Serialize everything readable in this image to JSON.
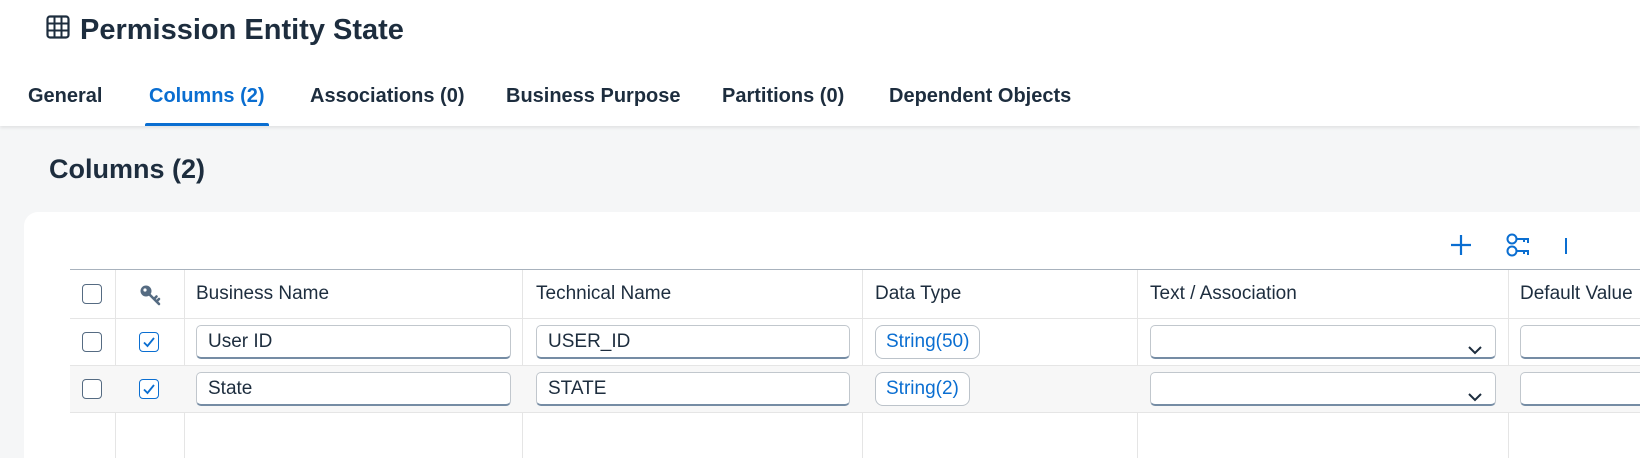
{
  "header": {
    "title": "Permission Entity State",
    "title_icon": "table-icon"
  },
  "tabs": [
    {
      "label": "General",
      "selected": false
    },
    {
      "label": "Columns (2)",
      "selected": true
    },
    {
      "label": "Associations (0)",
      "selected": false
    },
    {
      "label": "Business Purpose",
      "selected": false
    },
    {
      "label": "Partitions (0)",
      "selected": false
    },
    {
      "label": "Dependent Objects",
      "selected": false
    }
  ],
  "section": {
    "title": "Columns (2)"
  },
  "toolbar": {
    "add_icon": "add-icon",
    "keys_icon": "key-settings-icon"
  },
  "table": {
    "key_column_icon": "key-icon",
    "headers": {
      "business_name": "Business Name",
      "technical_name": "Technical Name",
      "data_type": "Data Type",
      "text_association": "Text / Association",
      "default": "Default Value"
    },
    "rows": [
      {
        "selected": false,
        "is_key": true,
        "business_name": "User ID",
        "technical_name": "USER_ID",
        "data_type": "String(50)",
        "text_association": ""
      },
      {
        "selected": false,
        "is_key": true,
        "business_name": "State",
        "technical_name": "STATE",
        "data_type": "String(2)",
        "text_association": ""
      }
    ]
  },
  "colors": {
    "accent": "#0a6ed1",
    "text": "#1d2d3e",
    "background": "#f5f6f7"
  }
}
